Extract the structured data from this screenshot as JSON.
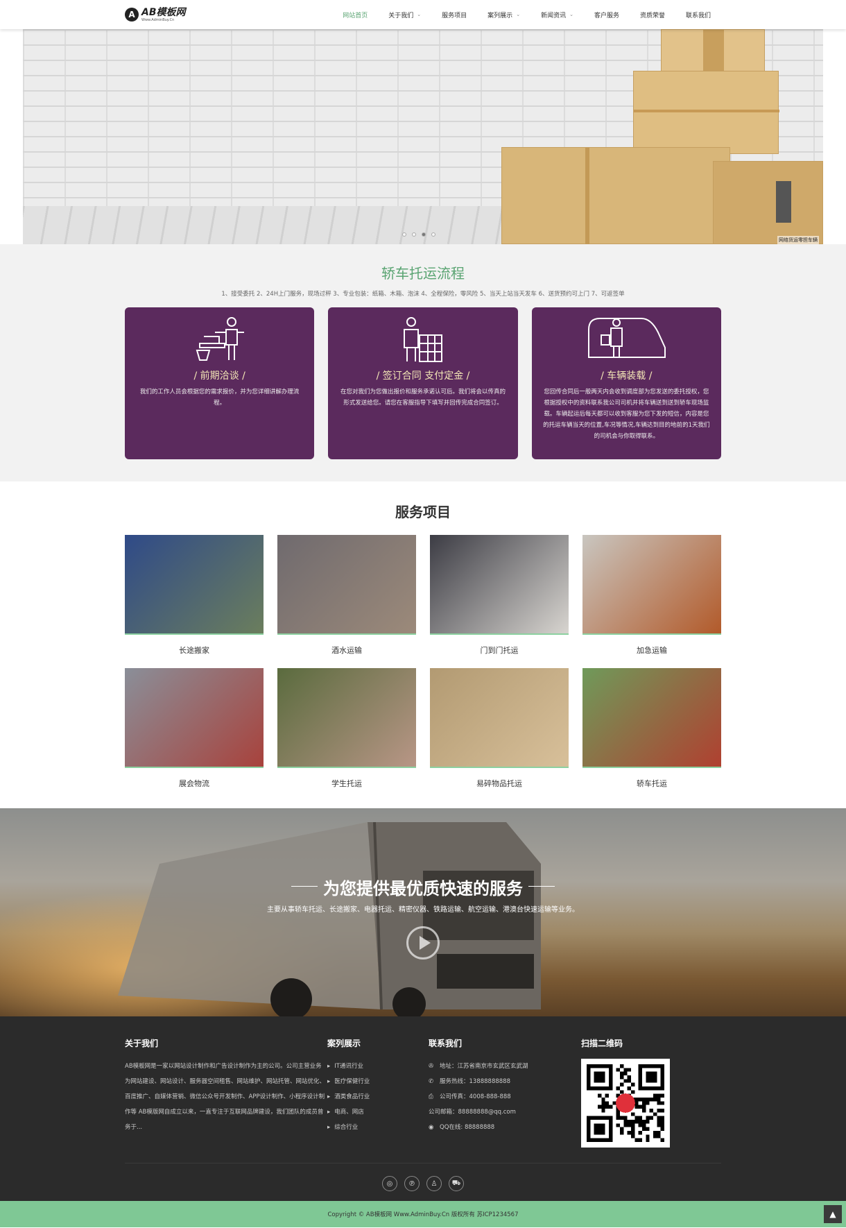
{
  "header": {
    "logo_mark": "A",
    "logo_name": "AB模板网",
    "logo_sub": "Www.AdminBuy.Cn",
    "nav": [
      {
        "label": "网站首页",
        "active": true,
        "dropdown": false
      },
      {
        "label": "关于我们",
        "active": false,
        "dropdown": true
      },
      {
        "label": "服务项目",
        "active": false,
        "dropdown": false
      },
      {
        "label": "案列展示",
        "active": false,
        "dropdown": true
      },
      {
        "label": "新闻资讯",
        "active": false,
        "dropdown": true
      },
      {
        "label": "客户服务",
        "active": false,
        "dropdown": false
      },
      {
        "label": "资质荣誉",
        "active": false,
        "dropdown": false
      },
      {
        "label": "联系我们",
        "active": false,
        "dropdown": false
      }
    ]
  },
  "banner": {
    "caption": "网络货运零担车辆",
    "slides": 4,
    "active_slide": 3
  },
  "process": {
    "title": "轿车托运流程",
    "subtitle": "1、接受委托 2、24H上门服务，现场过秤 3、专业包装：纸箱、木箱、泡沫 4、全程保险，零风险 5、当天上站当天发车 6、送货预约可上门 7、可返签单",
    "cards": [
      {
        "title": "/  前期洽谈  /",
        "icon": "consult-icon",
        "text": "我们的工作人员会根据您的需求报价，并为您详细讲解办理流程。"
      },
      {
        "title": "/  签订合同 支付定金  /",
        "icon": "contract-icon",
        "text": "在您对我们为您做出报价和服务承诺认可后。我们将会以传真的形式发送给您。请您在客服指导下填写并回传完成合同签订。"
      },
      {
        "title": "/  车辆装载  /",
        "icon": "truck-load-icon",
        "text": "您回传合同后一般两天内会收到调度部为您发送的委托授权，您根据授权中的资料联系我公司司机并将车辆送到送到轿车现场监载。车辆起运后每天都可以收到客服为您下发的短信，内容是您的托运车辆当天的位置,车况等情况,车辆达到目的地前的1天我们的司机会与你取得联系。"
      }
    ]
  },
  "services": {
    "title": "服务项目",
    "items": [
      {
        "label": "长途搬家",
        "c1": "#2f4a88",
        "c2": "#6b7e5d"
      },
      {
        "label": "酒水运输",
        "c1": "#6f6a6e",
        "c2": "#9c8a7a"
      },
      {
        "label": "门到门托运",
        "c1": "#3c3c44",
        "c2": "#d8d5d0"
      },
      {
        "label": "加急运输",
        "c1": "#c9c6c0",
        "c2": "#b25a2a"
      },
      {
        "label": "展会物流",
        "c1": "#8a8f99",
        "c2": "#a8423c"
      },
      {
        "label": "学生托运",
        "c1": "#5a6b3e",
        "c2": "#b89686"
      },
      {
        "label": "易碎物品托运",
        "c1": "#b29a72",
        "c2": "#d8c09a"
      },
      {
        "label": "轿车托运",
        "c1": "#6f9a5a",
        "c2": "#b04030"
      }
    ]
  },
  "band": {
    "title": "为您提供最优质快速的服务",
    "subtitle": "主要从事轿车托运、长途搬家、电器托运、精密仪器、铁路运输、航空运输、港澳台快速运输等业务。"
  },
  "footer": {
    "about_title": "关于我们",
    "about_text": "AB模板网是一家以网站设计制作和广告设计制作为主的公司。公司主营业务为网站建设、网站设计、服务器空间租售、网站维护、网站托管、网站优化、百度推广、自媒体营销、微信公众号开发制作、APP设计制作、小程序设计制作等 AB模版网自成立以来，一直专注于互联网品牌建设，我们团队的成员曾务于...",
    "cases_title": "案列展示",
    "cases": [
      "IT通讯行业",
      "医疗保健行业",
      "酒类食品行业",
      "电商、网店",
      "综合行业"
    ],
    "contact_title": "联系我们",
    "contact": [
      {
        "icon": "address-icon",
        "glyph": "✇",
        "text": "地址：江苏省南京市玄武区玄武湖"
      },
      {
        "icon": "phone-icon",
        "glyph": "✆",
        "text": "服务热线：13888888888"
      },
      {
        "icon": "fax-icon",
        "glyph": "⎙",
        "text": "公司传真：4008-888-888"
      },
      {
        "icon": "",
        "glyph": "",
        "text": "公司邮箱：88888888@qq.com"
      },
      {
        "icon": "qq-icon",
        "glyph": "◉",
        "text": "QQ在线: 88888888"
      }
    ],
    "qr_title": "扫描二维码",
    "social": [
      {
        "name": "weibo-icon",
        "glyph": "◎"
      },
      {
        "name": "pinterest-icon",
        "glyph": "℗"
      },
      {
        "name": "qq-penguin-icon",
        "glyph": "♙"
      },
      {
        "name": "cart-icon",
        "glyph": "⛟"
      }
    ],
    "copyright": "Copyright © AB模板网 Www.AdminBuy.Cn 版权所有    苏ICP1234567"
  },
  "colors": {
    "accent": "#5aa472",
    "card_bg": "#5b2a5d",
    "card_title": "#f4e7b6",
    "footer_bg": "#2b2b2b",
    "copyright_bg": "#7fc895"
  }
}
